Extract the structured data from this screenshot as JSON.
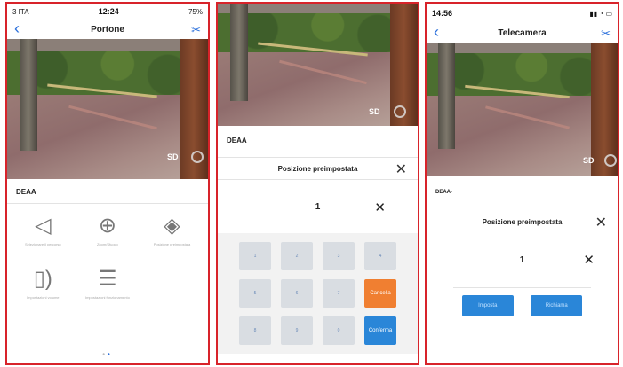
{
  "panel1": {
    "status": {
      "carrier": "3 ITA",
      "time": "12:24",
      "battery": "75%"
    },
    "nav": {
      "title": "Portone",
      "back_glyph": "‹",
      "tool_glyph": "✂"
    },
    "video": {
      "sd_label": "SD"
    },
    "device_label": "DEAA",
    "icons": [
      {
        "glyph": "◁",
        "caption": "Selezionare il percorso"
      },
      {
        "glyph": "⊕",
        "caption": "Zoom/Sfuoco"
      },
      {
        "glyph": "◈",
        "caption": "Posizione preimpostata"
      },
      {
        "glyph": "▯)",
        "caption": "Impostazioni volume"
      },
      {
        "glyph": "☰",
        "caption": "Impostazioni funzionamento"
      }
    ],
    "page_dots": [
      "•",
      "•"
    ]
  },
  "panel2": {
    "video": {
      "sd_label": "SD"
    },
    "device_label": "DEAA",
    "preset_title": "Posizione preimpostata",
    "close_glyph": "✕",
    "value": "1",
    "keypad": {
      "rows": [
        [
          "1",
          "2",
          "3",
          "4"
        ],
        [
          "5",
          "6",
          "7"
        ],
        [
          "8",
          "9",
          "0"
        ]
      ],
      "cancel_label": "Cancella",
      "confirm_label": "Conferma"
    }
  },
  "panel3": {
    "status": {
      "time": "14:56"
    },
    "nav": {
      "title": "Telecamera",
      "back_glyph": "‹",
      "tool_glyph": "✂"
    },
    "video": {
      "sd_label": "SD"
    },
    "device_label": "DEAA-",
    "preset_title": "Posizione preimpostata",
    "close_glyph": "✕",
    "value": "1",
    "buttons": {
      "set_label": "Imposta",
      "recall_label": "Richiama"
    }
  }
}
